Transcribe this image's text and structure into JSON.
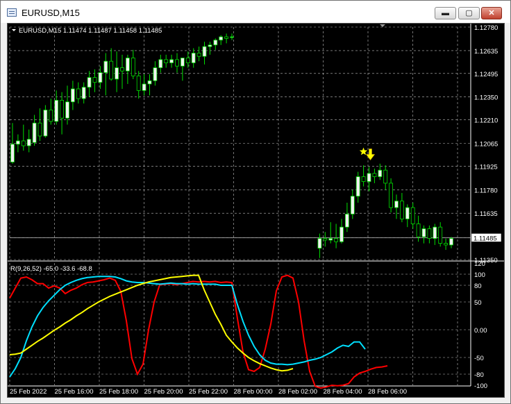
{
  "window": {
    "title": "EURUSD,M15",
    "buttons": {
      "minimize": "▬",
      "maximize": "▢",
      "close": "✕"
    }
  },
  "chart_data": {
    "type": "candlestick",
    "symbol_line": "EURUSD,M15  1.11474 1.11487 1.11458 1.11485",
    "price_ticks": [
      "1.12780",
      "1.12635",
      "1.12495",
      "1.12350",
      "1.12210",
      "1.12065",
      "1.11925",
      "1.11780",
      "1.11635",
      "1.11485",
      "1.11350"
    ],
    "current_price": "1.11485",
    "ylim": [
      1.1135,
      1.1278
    ],
    "time_ticks": [
      "25 Feb 2022",
      "25 Feb 16:00",
      "25 Feb 18:00",
      "25 Feb 20:00",
      "25 Feb 22:00",
      "28 Feb 00:00",
      "28 Feb 02:00",
      "28 Feb 04:00",
      "28 Feb 06:00"
    ],
    "candles": [
      [
        1.1195,
        1.1219,
        1.1194,
        1.1206
      ],
      [
        1.1206,
        1.1212,
        1.1201,
        1.1208
      ],
      [
        1.1208,
        1.1218,
        1.1202,
        1.1205
      ],
      [
        1.1205,
        1.1215,
        1.1201,
        1.1209
      ],
      [
        1.1207,
        1.1224,
        1.1205,
        1.1219
      ],
      [
        1.1219,
        1.1228,
        1.1208,
        1.1211
      ],
      [
        1.1211,
        1.123,
        1.121,
        1.1227
      ],
      [
        1.1227,
        1.1234,
        1.1218,
        1.122
      ],
      [
        1.122,
        1.1239,
        1.1218,
        1.1233
      ],
      [
        1.1233,
        1.1238,
        1.1212,
        1.1222
      ],
      [
        1.1222,
        1.1242,
        1.1218,
        1.1232
      ],
      [
        1.1232,
        1.1245,
        1.1227,
        1.124
      ],
      [
        1.124,
        1.1244,
        1.1231,
        1.1234
      ],
      [
        1.1234,
        1.1244,
        1.1231,
        1.1241
      ],
      [
        1.1241,
        1.1251,
        1.1235,
        1.1247
      ],
      [
        1.1247,
        1.1252,
        1.1238,
        1.1244
      ],
      [
        1.1244,
        1.1254,
        1.124,
        1.125
      ],
      [
        1.125,
        1.1262,
        1.1236,
        1.1257
      ],
      [
        1.1257,
        1.1265,
        1.1245,
        1.1246
      ],
      [
        1.1246,
        1.1263,
        1.1238,
        1.1253
      ],
      [
        1.1253,
        1.1261,
        1.124,
        1.1251
      ],
      [
        1.1251,
        1.1261,
        1.1243,
        1.1259
      ],
      [
        1.1259,
        1.1264,
        1.1246,
        1.1248
      ],
      [
        1.1248,
        1.1251,
        1.1234,
        1.1239
      ],
      [
        1.1239,
        1.1249,
        1.1236,
        1.1243
      ],
      [
        1.1243,
        1.1249,
        1.1236,
        1.1245
      ],
      [
        1.1245,
        1.1257,
        1.1242,
        1.1253
      ],
      [
        1.1253,
        1.1261,
        1.125,
        1.1258
      ],
      [
        1.1258,
        1.1261,
        1.1253,
        1.1256
      ],
      [
        1.1256,
        1.1261,
        1.1253,
        1.1258
      ],
      [
        1.1258,
        1.1262,
        1.125,
        1.1254
      ],
      [
        1.1254,
        1.1259,
        1.1245,
        1.1259
      ],
      [
        1.1259,
        1.1263,
        1.1253,
        1.1256
      ],
      [
        1.1256,
        1.1265,
        1.1253,
        1.1262
      ],
      [
        1.1262,
        1.1266,
        1.1257,
        1.126
      ],
      [
        1.126,
        1.1269,
        1.1255,
        1.1266
      ],
      [
        1.1266,
        1.1269,
        1.1261,
        1.1267
      ],
      [
        1.1267,
        1.1271,
        1.1264,
        1.127
      ],
      [
        1.127,
        1.1273,
        1.1267,
        1.1272
      ],
      [
        1.1272,
        1.1274,
        1.1268,
        1.1271
      ],
      [
        1.1272,
        1.1274,
        1.127,
        1.1272
      ],
      null,
      null,
      null,
      null,
      null,
      null,
      null,
      null,
      null,
      null,
      null,
      null,
      null,
      null,
      null,
      [
        1.1142,
        1.1151,
        1.1136,
        1.1148
      ],
      [
        1.1148,
        1.1152,
        1.1143,
        1.1147
      ],
      [
        1.1147,
        1.1158,
        1.1145,
        1.1148
      ],
      [
        1.1148,
        1.1157,
        1.1142,
        1.1146
      ],
      [
        1.1146,
        1.116,
        1.1145,
        1.1155
      ],
      [
        1.1155,
        1.117,
        1.1152,
        1.1163
      ],
      [
        1.1163,
        1.1178,
        1.116,
        1.1174
      ],
      [
        1.1174,
        1.1189,
        1.117,
        1.1186
      ],
      [
        1.1186,
        1.1193,
        1.118,
        1.1183
      ],
      [
        1.1183,
        1.1192,
        1.1177,
        1.1188
      ],
      [
        1.1188,
        1.1191,
        1.1182,
        1.1186
      ],
      [
        1.1186,
        1.1194,
        1.1184,
        1.119
      ],
      [
        1.119,
        1.1193,
        1.1178,
        1.1182
      ],
      [
        1.1182,
        1.1185,
        1.1164,
        1.1167
      ],
      [
        1.1167,
        1.1175,
        1.116,
        1.1171
      ],
      [
        1.1171,
        1.1176,
        1.1158,
        1.116
      ],
      [
        1.116,
        1.1169,
        1.1155,
        1.1167
      ],
      [
        1.1167,
        1.117,
        1.1154,
        1.1157
      ],
      [
        1.1157,
        1.1162,
        1.1146,
        1.1149
      ],
      [
        1.1149,
        1.1156,
        1.1145,
        1.1154
      ],
      [
        1.1154,
        1.1156,
        1.1145,
        1.1148
      ],
      [
        1.1148,
        1.1157,
        1.1144,
        1.1155
      ],
      [
        1.1155,
        1.1158,
        1.1143,
        1.1145
      ],
      [
        1.1145,
        1.1148,
        1.1141,
        1.1144
      ],
      [
        1.1144,
        1.1149,
        1.1142,
        1.1148
      ]
    ],
    "bull_color": "#f0f0f0",
    "bear_color": "#000000",
    "wick_color": "#00e000",
    "grid_color": "#c0c0c0",
    "signal_index": 65,
    "signal_color": "#ffff00",
    "indicator": {
      "label": "R(9,26,52) -65.0 -33.6 -68.8",
      "ticks": [
        "120",
        "100",
        "80",
        "50",
        "0.00",
        "-50",
        "-80",
        "-100"
      ],
      "ylim": [
        -100,
        120
      ],
      "series": [
        {
          "color": "#ff0000",
          "values": [
            57,
            75,
            93,
            95,
            90,
            83,
            83,
            75,
            79,
            75,
            65,
            71,
            75,
            81,
            85,
            86,
            88,
            90,
            93,
            89,
            69,
            16,
            -52,
            -80,
            -62,
            0,
            50,
            81,
            82,
            83,
            81,
            83,
            85,
            87,
            86,
            87,
            86,
            87,
            85,
            86,
            85,
            20,
            -40,
            -72,
            -75,
            -68,
            -35,
            10,
            70,
            95,
            98,
            93,
            50,
            -20,
            -75,
            -102,
            -105,
            -103,
            -100,
            -101,
            -100,
            -97,
            -85,
            -78,
            -75,
            -71,
            -68,
            -67,
            -65
          ]
        },
        {
          "color": "#00e0ff",
          "values": [
            -85,
            -70,
            -50,
            -20,
            5,
            25,
            40,
            52,
            62,
            72,
            80,
            85,
            89,
            92,
            94,
            95,
            96,
            96,
            96,
            95,
            92,
            88,
            86,
            85,
            85,
            84,
            83,
            82,
            83,
            84,
            83,
            83,
            82,
            83,
            82,
            82,
            82,
            82,
            80,
            80,
            80,
            45,
            15,
            -10,
            -30,
            -45,
            -55,
            -60,
            -62,
            -62,
            -63,
            -62,
            -60,
            -58,
            -55,
            -53,
            -50,
            -45,
            -40,
            -33,
            -28,
            -30,
            -22,
            -22,
            -35
          ]
        },
        {
          "color": "#ffff00",
          "values": [
            -45,
            -44,
            -42,
            -35,
            -28,
            -21,
            -15,
            -8,
            -1,
            5,
            12,
            18,
            25,
            31,
            38,
            44,
            50,
            55,
            60,
            64,
            68,
            72,
            76,
            80,
            83,
            86,
            88,
            90,
            92,
            94,
            95,
            96,
            97,
            98,
            98,
            72,
            50,
            28,
            10,
            -10,
            -22,
            -33,
            -42,
            -50,
            -56,
            -61,
            -65,
            -69,
            -72,
            -74,
            -73,
            -70
          ]
        }
      ]
    }
  }
}
